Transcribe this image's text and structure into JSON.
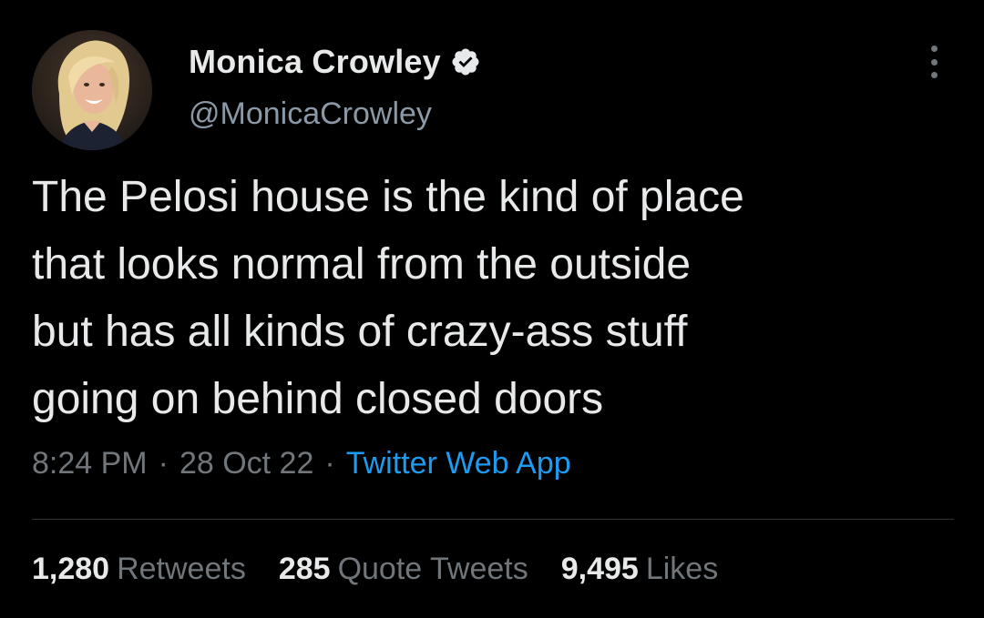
{
  "author": {
    "display_name": "Monica Crowley",
    "handle": "@MonicaCrowley",
    "verified": true
  },
  "icons": {
    "verified": "verified-badge-icon",
    "more": "more-options-icon"
  },
  "tweet": {
    "lines": [
      "The Pelosi house is the kind of place",
      "that looks normal from the outside",
      "but has all kinds of crazy-ass stuff",
      "going on behind closed doors"
    ]
  },
  "meta": {
    "time": "8:24 PM",
    "separator": "·",
    "date": "28 Oct 22",
    "source": "Twitter Web App"
  },
  "stats": {
    "retweets_count": "1,280",
    "retweets_label": "Retweets",
    "quotes_count": "285",
    "quotes_label": "Quote Tweets",
    "likes_count": "9,495",
    "likes_label": "Likes"
  },
  "colors": {
    "background": "#000000",
    "text": "#e7e9ea",
    "muted": "#71767b",
    "link": "#1d9bf0"
  }
}
